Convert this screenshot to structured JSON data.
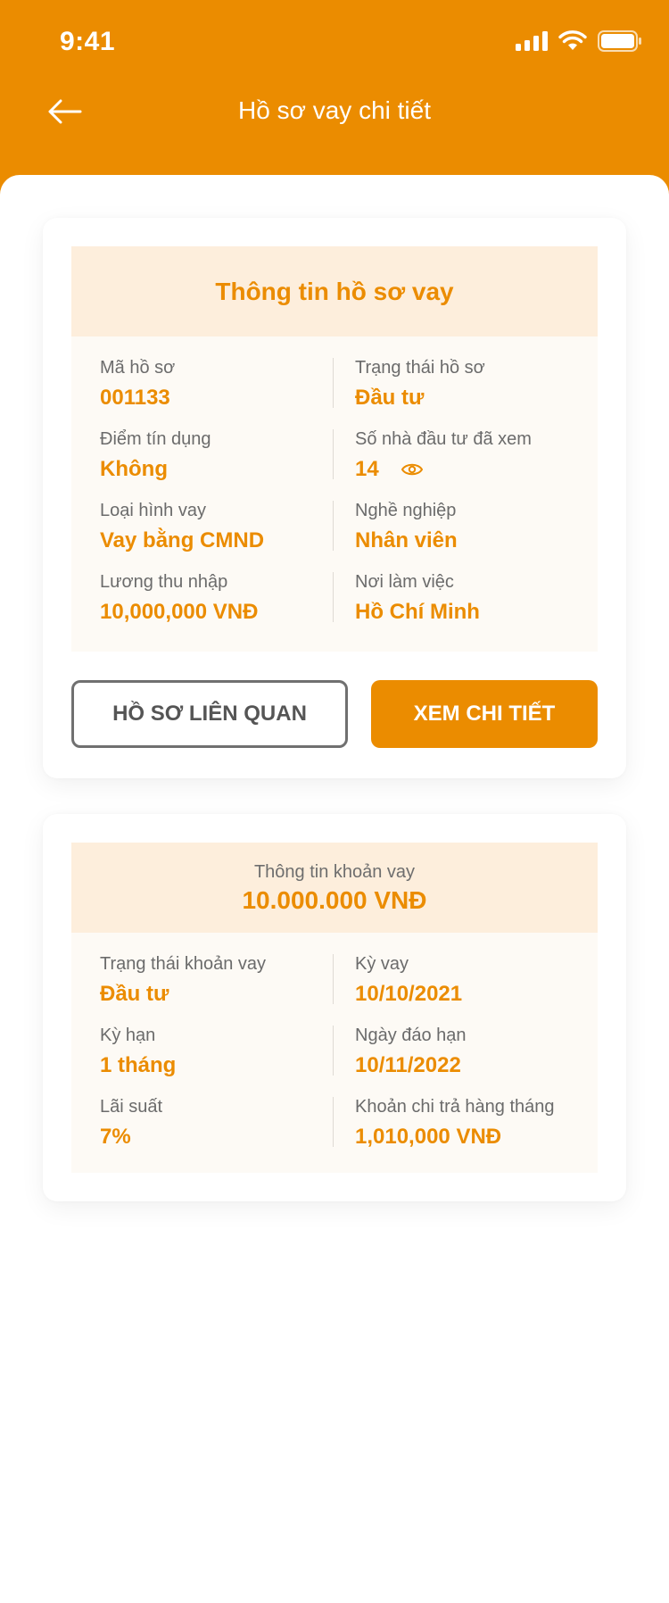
{
  "status_bar": {
    "time": "9:41",
    "icons": [
      "signal-icon",
      "wifi-icon",
      "battery-icon"
    ]
  },
  "header": {
    "title": "Hồ sơ vay chi tiết",
    "back_icon": "arrow-left-icon"
  },
  "profile_card": {
    "title": "Thông tin hồ sơ vay",
    "rows": [
      {
        "left": {
          "label": "Mã hồ sơ",
          "value": "001133"
        },
        "right": {
          "label": "Trạng thái hồ sơ",
          "value": "Đầu tư"
        }
      },
      {
        "left": {
          "label": "Điểm tín dụng",
          "value": "Không"
        },
        "right": {
          "label": "Số nhà đầu tư đã xem",
          "value": "14",
          "icon": "eye-icon"
        }
      },
      {
        "left": {
          "label": "Loại hình vay",
          "value": "Vay bằng CMND"
        },
        "right": {
          "label": "Nghề nghiệp",
          "value": "Nhân viên"
        }
      },
      {
        "left": {
          "label": "Lương thu nhập",
          "value": "10,000,000 VNĐ"
        },
        "right": {
          "label": "Nơi làm việc",
          "value": "Hồ Chí Minh"
        }
      }
    ],
    "buttons": {
      "related_label": "HỒ SƠ LIÊN QUAN",
      "detail_label": "XEM CHI TIẾT"
    }
  },
  "loan_card": {
    "subtitle": "Thông tin khoản vay",
    "amount": "10.000.000 VNĐ",
    "rows": [
      {
        "left": {
          "label": "Trạng thái khoản vay",
          "value": "Đầu tư"
        },
        "right": {
          "label": "Kỳ vay",
          "value": "10/10/2021"
        }
      },
      {
        "left": {
          "label": "Kỳ hạn",
          "value": "1 tháng"
        },
        "right": {
          "label": "Ngày đáo hạn",
          "value": "10/11/2022"
        }
      },
      {
        "left": {
          "label": "Lãi suất",
          "value": "7%"
        },
        "right": {
          "label": "Khoản chi trả hàng tháng",
          "value": "1,010,000 VNĐ"
        }
      }
    ]
  },
  "colors": {
    "primary": "#EB8C00",
    "panel_head": "#FDEEDC",
    "panel_body": "#FDFAF5",
    "label": "#6B6B6B"
  }
}
